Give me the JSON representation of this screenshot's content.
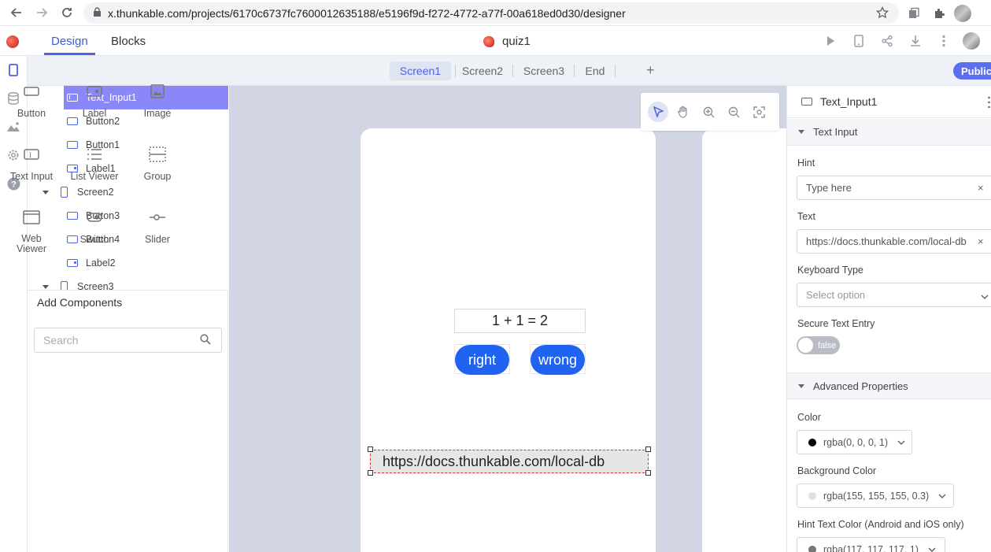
{
  "browser": {
    "url": "x.thunkable.com/projects/6170c6737fc7600012635188/e5196f9d-f272-4772-a77f-00a618ed0d30/designer"
  },
  "header": {
    "tab_design": "Design",
    "tab_blocks": "Blocks",
    "project_title": "quiz1"
  },
  "screens": {
    "tabs": [
      "Screen1",
      "Screen2",
      "Screen3",
      "End"
    ],
    "active": "Screen1",
    "add": "+",
    "public_label": "Public"
  },
  "tree": {
    "items": [
      {
        "label": "Text_Input1",
        "type": "input",
        "selected": true
      },
      {
        "label": "Button2",
        "type": "button"
      },
      {
        "label": "Button1",
        "type": "button"
      },
      {
        "label": "Label1",
        "type": "label"
      },
      {
        "label": "Screen2",
        "type": "screen"
      },
      {
        "label": "Button3",
        "type": "button"
      },
      {
        "label": "Button4",
        "type": "button"
      },
      {
        "label": "Label2",
        "type": "label"
      },
      {
        "label": "Screen3",
        "type": "screen"
      }
    ]
  },
  "add_components": {
    "title": "Add Components",
    "search_placeholder": "Search",
    "items": [
      "Button",
      "Label",
      "Image",
      "Text Input",
      "List Viewer",
      "Group",
      "Web Viewer",
      "Switch",
      "Slider"
    ]
  },
  "canvas": {
    "question": "1 + 1 = 2",
    "btn_right": "right",
    "btn_wrong": "wrong",
    "input_text": "https://docs.thunkable.com/local-db"
  },
  "properties": {
    "component_name": "Text_Input1",
    "section_text_input": "Text Input",
    "hint_label": "Hint",
    "hint_value": "Type here",
    "text_label": "Text",
    "text_value": "https://docs.thunkable.com/local-db",
    "keyboard_label": "Keyboard Type",
    "keyboard_placeholder": "Select option",
    "secure_label": "Secure Text Entry",
    "secure_value": "false",
    "section_advanced": "Advanced Properties",
    "color_label": "Color",
    "color_value": "rgba(0, 0, 0, 1)",
    "bg_label": "Background Color",
    "bg_value": "rgba(155, 155, 155, 0.3)",
    "hint_color_label": "Hint Text Color (Android and iOS only)",
    "hint_color_value": "rgba(117, 117, 117, 1)"
  },
  "colors": {
    "accent": "#4d63e0",
    "button_blue": "#1f63f0",
    "selection": "#8a87f8"
  }
}
